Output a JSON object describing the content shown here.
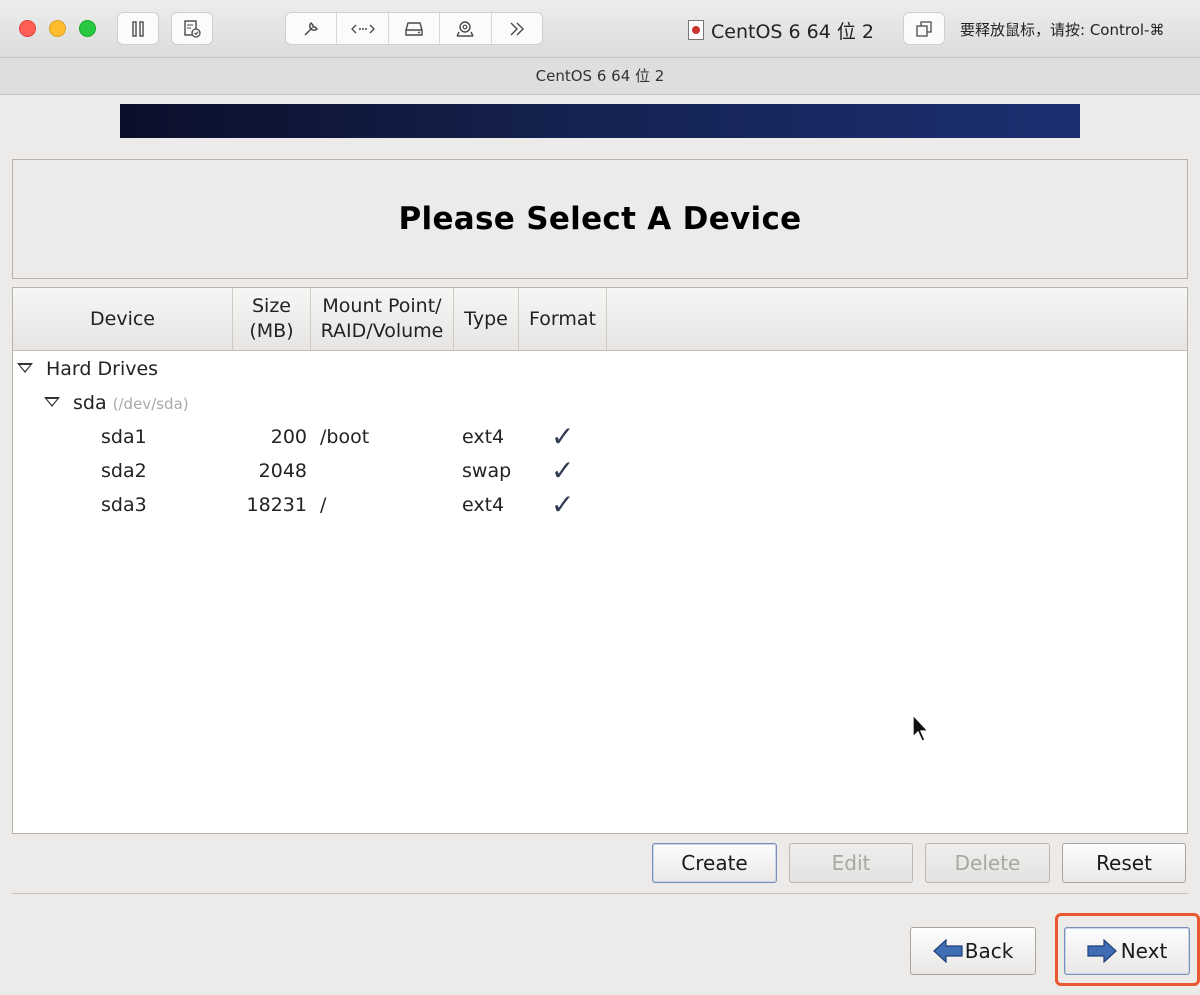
{
  "mac_window": {
    "vm_name": "CentOS 6 64 位 2",
    "release_hint": "要释放鼠标，请按: Control-⌘",
    "subtitle": "CentOS 6 64 位 2",
    "toolbar_icons": [
      "pause-icon",
      "snapshot-icon",
      "wrench-icon",
      "network-icon",
      "disk-icon",
      "camera-icon",
      "more-chevron-icon"
    ]
  },
  "installer": {
    "title": "Please Select A Device",
    "columns": {
      "device": "Device",
      "size_line1": "Size",
      "size_line2": "(MB)",
      "mount_line1": "Mount Point/",
      "mount_line2": "RAID/Volume",
      "type": "Type",
      "format": "Format"
    },
    "tree": {
      "group_label": "Hard Drives",
      "disk_name": "sda",
      "disk_path": "(/dev/sda)",
      "partitions": [
        {
          "name": "sda1",
          "size": "200",
          "mount": "/boot",
          "type": "ext4",
          "format": "✓"
        },
        {
          "name": "sda2",
          "size": "2048",
          "mount": "",
          "type": "swap",
          "format": "✓"
        },
        {
          "name": "sda3",
          "size": "18231",
          "mount": "/",
          "type": "ext4",
          "format": "✓"
        }
      ]
    },
    "actions": {
      "create": "Create",
      "edit": "Edit",
      "delete": "Delete",
      "reset": "Reset"
    },
    "nav": {
      "back": "Back",
      "next": "Next"
    }
  }
}
